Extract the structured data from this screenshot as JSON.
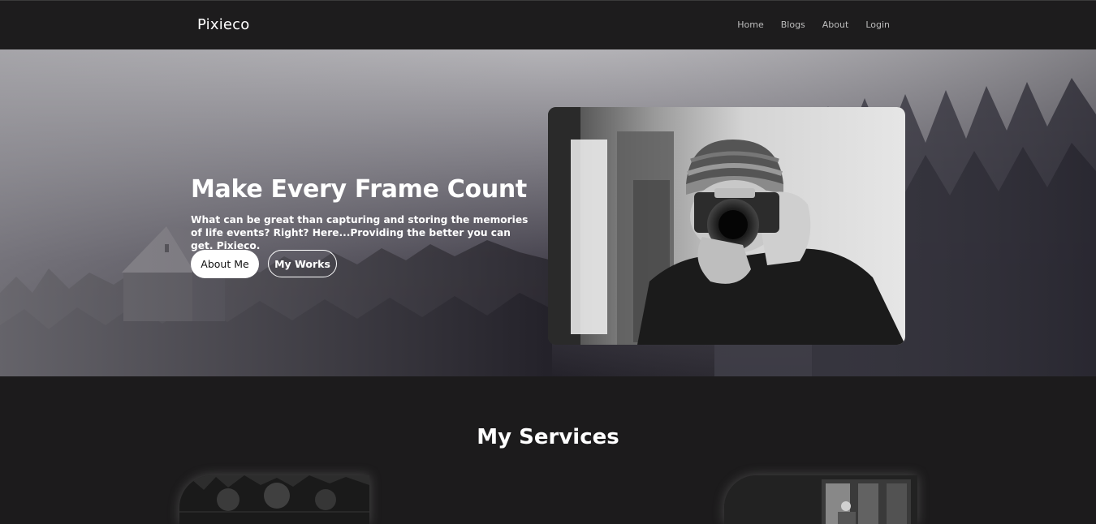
{
  "navbar": {
    "brand": "Pixieco",
    "links": [
      "Home",
      "Blogs",
      "About",
      "Login"
    ]
  },
  "hero": {
    "title": "Make Every Frame Count",
    "text": "What can be great than capturing and storing the memories of life events? Right? Here...Providing the better you can get. Pixieco.",
    "primary_button": "About Me",
    "secondary_button": "My Works",
    "photo_icon": "photographer-photo",
    "background_icon": "foggy-forest-background"
  },
  "services": {
    "title": "My Services",
    "cards": [
      {
        "icon": "forest-thumbnail"
      },
      {
        "icon": "interior-thumbnail"
      }
    ]
  },
  "colors": {
    "page_bg": "#1c1b1c",
    "navbar_bg": "#1d1c1d",
    "nav_link": "#bdbdbd",
    "text": "#ffffff"
  }
}
